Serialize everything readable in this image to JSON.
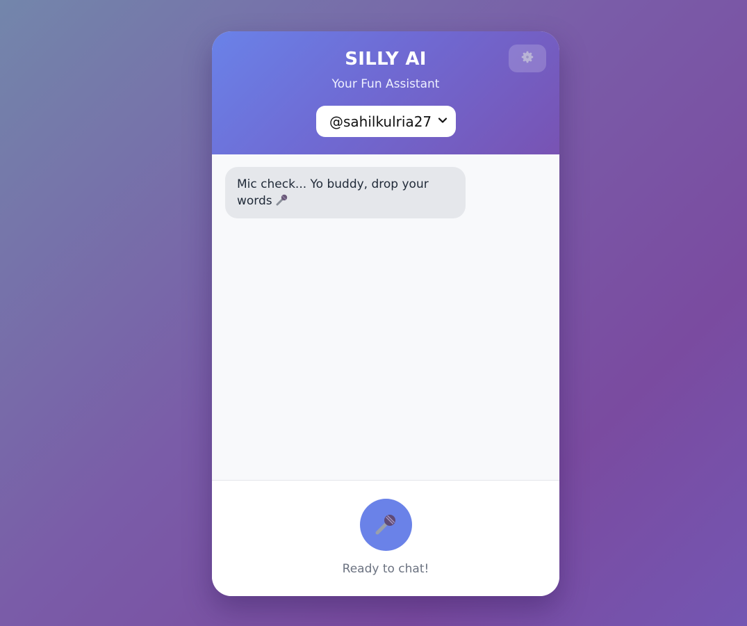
{
  "header": {
    "title": "SILLY AI",
    "subtitle": "Your Fun Assistant",
    "settings_icon": "gear-icon",
    "user_select": {
      "selected": "@sahilkulria27",
      "icon": "chevron-down-icon"
    }
  },
  "chat": {
    "messages": [
      {
        "role": "assistant",
        "text": "Mic check... Yo buddy, drop your words",
        "emoji_icon": "microphone-icon"
      }
    ]
  },
  "footer": {
    "mic_button_icon": "microphone-icon",
    "status": "Ready to chat!"
  },
  "colors": {
    "header_gradient_start": "#6a82e8",
    "header_gradient_end": "#7853b3",
    "mic_button": "#6a82e8",
    "bubble_bg": "#e5e7eb",
    "status_text": "#6b7280"
  }
}
